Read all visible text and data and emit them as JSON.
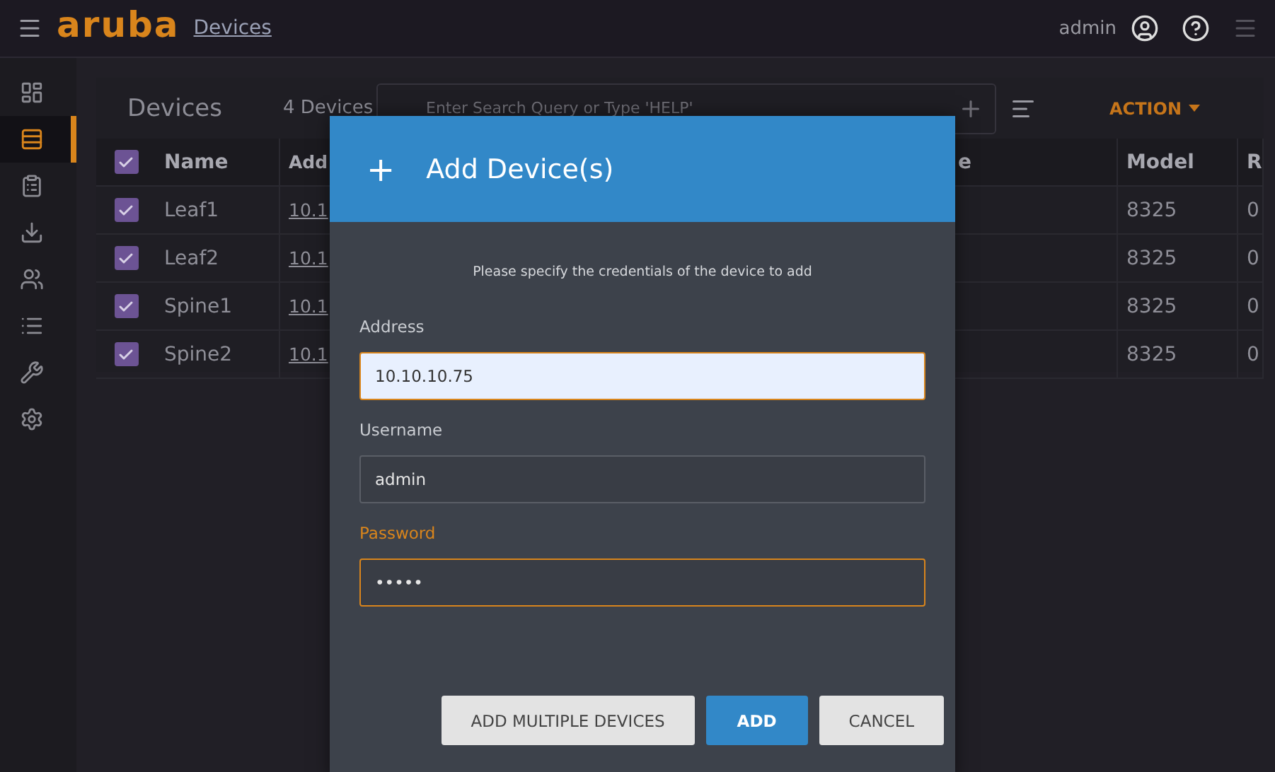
{
  "top_bar": {
    "logo": "aruba",
    "breadcrumb": "Devices",
    "user": "admin"
  },
  "sidebar": {
    "items": [
      {
        "kind": "dashboard",
        "selected": false
      },
      {
        "kind": "devices",
        "selected": true
      },
      {
        "kind": "clipboard",
        "selected": false
      },
      {
        "kind": "download",
        "selected": false
      },
      {
        "kind": "users",
        "selected": false
      },
      {
        "kind": "list",
        "selected": false
      },
      {
        "kind": "wrench",
        "selected": false
      },
      {
        "kind": "gear",
        "selected": false
      }
    ]
  },
  "panel": {
    "title": "Devices",
    "count": "4 Devices",
    "search": {
      "placeholder": "Enter Search Query or Type 'HELP'"
    },
    "action": "ACTION",
    "table": {
      "header_checked": true,
      "columns": [
        "Name",
        "Add",
        "e",
        "Model",
        "R"
      ],
      "rows": [
        {
          "checked": true,
          "cells": [
            "Leaf1",
            "10.1",
            null,
            "8325",
            "0"
          ]
        },
        {
          "checked": true,
          "cells": [
            "Leaf2",
            "10.1",
            null,
            "8325",
            "0"
          ]
        },
        {
          "checked": true,
          "cells": [
            "Spine1",
            "10.1",
            null,
            "8325",
            "0"
          ]
        },
        {
          "checked": true,
          "cells": [
            "Spine2",
            "10.1",
            null,
            "8325",
            "0"
          ]
        }
      ]
    }
  },
  "dialog": {
    "icon": "+",
    "title": "Add Device(s)",
    "message": "Please specify the credentials of the device to add",
    "fields": [
      {
        "label": "Address",
        "value": "10.10.10.75",
        "kind": "autofilled",
        "focused": false
      },
      {
        "label": "Username",
        "value": "admin",
        "kind": "text",
        "focused": false
      },
      {
        "label": "Password",
        "value": "•••••",
        "kind": "text",
        "focused": true
      }
    ],
    "buttons": [
      {
        "label": "ADD MULTIPLE DEVICES",
        "primary": false
      },
      {
        "label": "ADD",
        "primary": true
      },
      {
        "label": "CANCEL",
        "primary": false
      }
    ]
  }
}
